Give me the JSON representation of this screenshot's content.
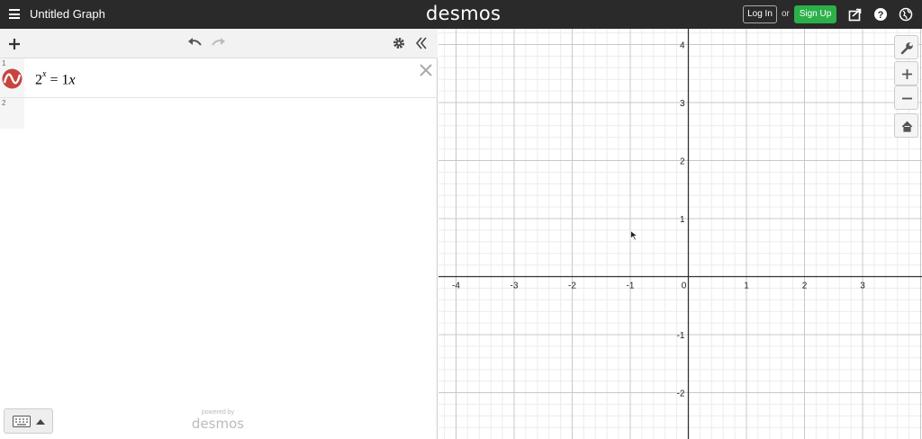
{
  "header": {
    "title": "Untitled Graph",
    "brand": "desmos",
    "login_label": "Log In",
    "or_text": "or",
    "signup_label": "Sign Up",
    "signup_color": "#2bb04a",
    "icons": [
      "menu-icon",
      "share-icon",
      "help-icon",
      "globe-icon"
    ]
  },
  "expressions": {
    "toolbar_icons": [
      "add-icon",
      "undo-icon",
      "redo-icon",
      "settings-icon",
      "collapse-icon"
    ],
    "items": [
      {
        "number": "1",
        "base": "2",
        "exponent": "x",
        "rhs_coefficient": "1",
        "rhs_variable": "x",
        "color": "#c74440"
      },
      {
        "number": "2"
      }
    ]
  },
  "footer": {
    "powered_by": "powered by",
    "brand": "desmos",
    "keypad_icons": [
      "keyboard-icon",
      "caret-up-icon"
    ]
  },
  "graph": {
    "x_ticks": [
      "-4",
      "-3",
      "-2",
      "-1",
      "0",
      "1",
      "2",
      "3"
    ],
    "y_ticks": [
      "4",
      "3",
      "2",
      "1",
      "-1",
      "-2"
    ],
    "xlim": [
      -4.4,
      3.9
    ],
    "ylim": [
      -2.8,
      4.2
    ],
    "grid": true,
    "side_icons": [
      "wrench-icon",
      "zoom-in-icon",
      "zoom-out-icon",
      "home-icon"
    ]
  }
}
